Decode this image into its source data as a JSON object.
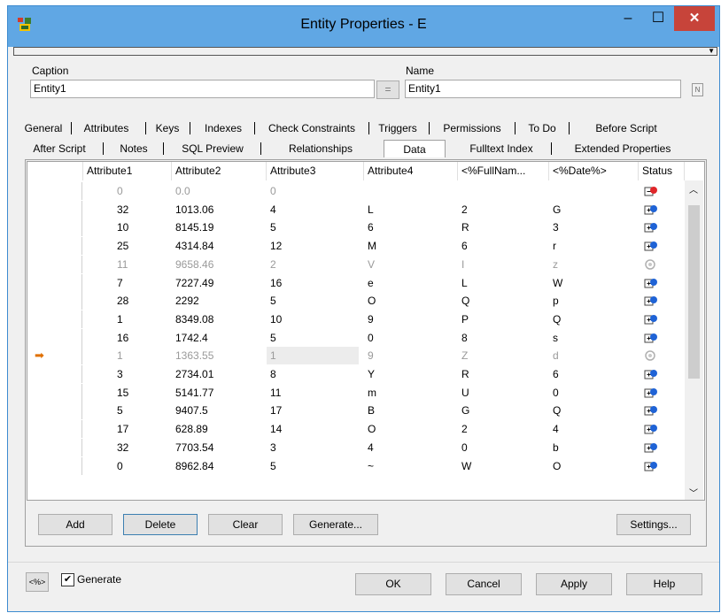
{
  "window": {
    "title": "Entity Properties - E"
  },
  "titlebar": {
    "minimize_glyph": "–",
    "maximize_glyph": "☐",
    "close_glyph": "✕"
  },
  "form": {
    "caption_label": "Caption",
    "caption_value": "Entity1",
    "equals_label": "=",
    "name_label": "Name",
    "name_value": "Entity1"
  },
  "tabs_row1": [
    "General",
    "Attributes",
    "Keys",
    "Indexes",
    "Check Constraints",
    "Triggers",
    "Permissions",
    "To Do",
    "Before Script"
  ],
  "tabs_row2": [
    "After Script",
    "Notes",
    "SQL Preview",
    "Relationships",
    "Data",
    "Fulltext Index",
    "Extended Properties"
  ],
  "active_tab": "Data",
  "table": {
    "columns": [
      "Attribute1",
      "Attribute2",
      "Attribute3",
      "Attribute4",
      "<%FullNam...",
      "<%Date%>",
      "Status"
    ],
    "rows": [
      {
        "cells": [
          "0",
          "0.0",
          "0",
          "",
          "",
          ""
        ],
        "status": "new-row",
        "grey": true
      },
      {
        "cells": [
          "32",
          "1013.06",
          "4",
          "L",
          "2",
          "G"
        ],
        "status": "insert"
      },
      {
        "cells": [
          "10",
          "8145.19",
          "5",
          "6",
          "R",
          "3"
        ],
        "status": "insert"
      },
      {
        "cells": [
          "25",
          "4314.84",
          "12",
          "M",
          "6",
          "r"
        ],
        "status": "insert"
      },
      {
        "cells": [
          "11",
          "9658.46",
          "2",
          "V",
          "I",
          "z"
        ],
        "status": "disabled",
        "grey": true
      },
      {
        "cells": [
          "7",
          "7227.49",
          "16",
          "e",
          "L",
          "W"
        ],
        "status": "insert"
      },
      {
        "cells": [
          "28",
          "2292",
          "5",
          "O",
          "Q",
          "p"
        ],
        "status": "insert"
      },
      {
        "cells": [
          "1",
          "8349.08",
          "10",
          "9",
          "P",
          "Q"
        ],
        "status": "insert"
      },
      {
        "cells": [
          "16",
          "1742.4",
          "5",
          "0",
          "8",
          "s"
        ],
        "status": "insert"
      },
      {
        "cells": [
          "1",
          "1363.55",
          "1",
          "9",
          "Z",
          "d"
        ],
        "status": "disabled",
        "grey": true,
        "current": true
      },
      {
        "cells": [
          "3",
          "2734.01",
          "8",
          "Y",
          "R",
          "6"
        ],
        "status": "insert"
      },
      {
        "cells": [
          "15",
          "5141.77",
          "11",
          "m",
          "U",
          "0"
        ],
        "status": "insert"
      },
      {
        "cells": [
          "5",
          "9407.5",
          "17",
          "B",
          "G",
          "Q"
        ],
        "status": "insert"
      },
      {
        "cells": [
          "17",
          "628.89",
          "14",
          "O",
          "2",
          "4"
        ],
        "status": "insert"
      },
      {
        "cells": [
          "32",
          "7703.54",
          "3",
          "4",
          "0",
          "b"
        ],
        "status": "insert"
      },
      {
        "cells": [
          "0",
          "8962.84",
          "5",
          "~",
          "W",
          "O"
        ],
        "status": "insert"
      }
    ],
    "current_row_marker": "➡"
  },
  "data_buttons": {
    "add": "Add",
    "delete": "Delete",
    "clear": "Clear",
    "generate": "Generate...",
    "settings": "Settings..."
  },
  "footer": {
    "macro_button": "<%>",
    "generate_checkbox_label": "Generate",
    "generate_checked": true,
    "ok": "OK",
    "cancel": "Cancel",
    "apply": "Apply",
    "help": "Help"
  },
  "colors": {
    "titlebar": "#60a7e4",
    "close": "#c7443a",
    "arrow": "#e07000"
  }
}
